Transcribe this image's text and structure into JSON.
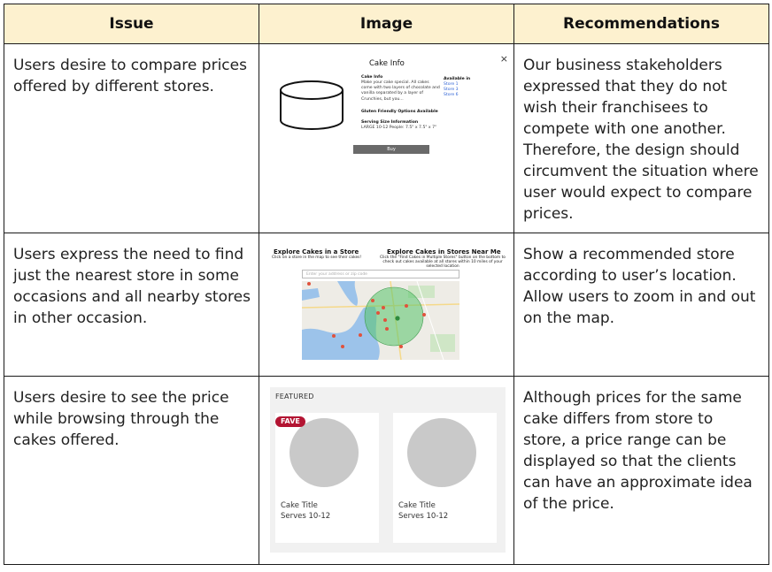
{
  "headers": [
    "Issue",
    "Image",
    "Recommendations"
  ],
  "rows": [
    {
      "issue": "Users desire to compare prices offered by different stores.",
      "recommendation": "Our business stakeholders expressed that they do not wish their franchisees to compete with one another. Therefore, the design should circumvent the situation where user would expect to compare prices.",
      "mock": {
        "title": "Cake Info",
        "close": "×",
        "section1_heading": "Cake Info",
        "section1_text": "Make your cake special. All cakes come with two layers of chocolate and vanilla separated by a layer of Crunchies, but you...",
        "available_heading": "Available in",
        "stores": [
          "Store 1",
          "Store 3",
          "Store 6"
        ],
        "gluten": "Gluten Friendly Options Available",
        "serving_heading": "Serving Size Information",
        "serving_text": "LARGE 10-12 People: 7.5\" x 7.5\" x 7\"",
        "buy": "Buy"
      }
    },
    {
      "issue": "Users express the need to find just the nearest store in some occasions and all nearby stores in other occasion.",
      "recommendation": "Show a recommended store according to user’s location. Allow users to zoom in and out on the map.",
      "mock": {
        "left_heading": "Explore Cakes in a Store",
        "left_sub": "Click on a store in the map to see their cakes!",
        "right_heading": "Explore Cakes in Stores Near Me",
        "right_sub": "Click the \"Find Cakes in Multiple Stores\" button on the bottom to check out cakes available at all stores within 10 miles of your selected location",
        "search_placeholder": "Enter your address or zip code"
      }
    },
    {
      "issue": "Users desire to see the price while browsing through the cakes offered.",
      "recommendation": "Although prices for the same cake differs from store to store, a price range can be displayed so that the clients can have an approximate idea of the price.",
      "mock": {
        "featured": "FEATURED",
        "fave": "FAVE",
        "cards": [
          {
            "title": "Cake Title",
            "serves": "Serves 10-12"
          },
          {
            "title": "Cake Title",
            "serves": "Serves 10-12"
          }
        ]
      }
    }
  ],
  "colors": {
    "header_bg": "#fdf1cf",
    "fave": "#b31432",
    "map_radius": "#57c46a"
  }
}
